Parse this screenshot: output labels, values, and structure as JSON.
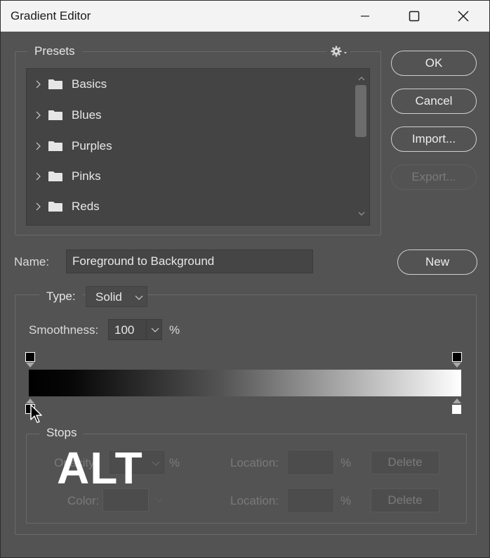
{
  "window": {
    "title": "Gradient Editor"
  },
  "presets": {
    "legend": "Presets",
    "items": [
      {
        "label": "Basics"
      },
      {
        "label": "Blues"
      },
      {
        "label": "Purples"
      },
      {
        "label": "Pinks"
      },
      {
        "label": "Reds"
      }
    ]
  },
  "buttons": {
    "ok": "OK",
    "cancel": "Cancel",
    "import": "Import...",
    "export": "Export...",
    "new": "New"
  },
  "name": {
    "label": "Name:",
    "value": "Foreground to Background"
  },
  "type": {
    "label": "Type:",
    "value": "Solid"
  },
  "smoothness": {
    "label": "Smoothness:",
    "value": "100",
    "unit": "%"
  },
  "stops": {
    "legend": "Stops",
    "opacity_label": "Opacity:",
    "opacity_unit": "%",
    "location_label_1": "Location:",
    "location_unit_1": "%",
    "delete_1": "Delete",
    "color_label": "Color:",
    "location_label_2": "Location:",
    "location_unit_2": "%",
    "delete_2": "Delete"
  },
  "overlay": {
    "alt_text": "ALT"
  },
  "gradient": {
    "start_color": "#000000",
    "end_color": "#ffffff"
  }
}
